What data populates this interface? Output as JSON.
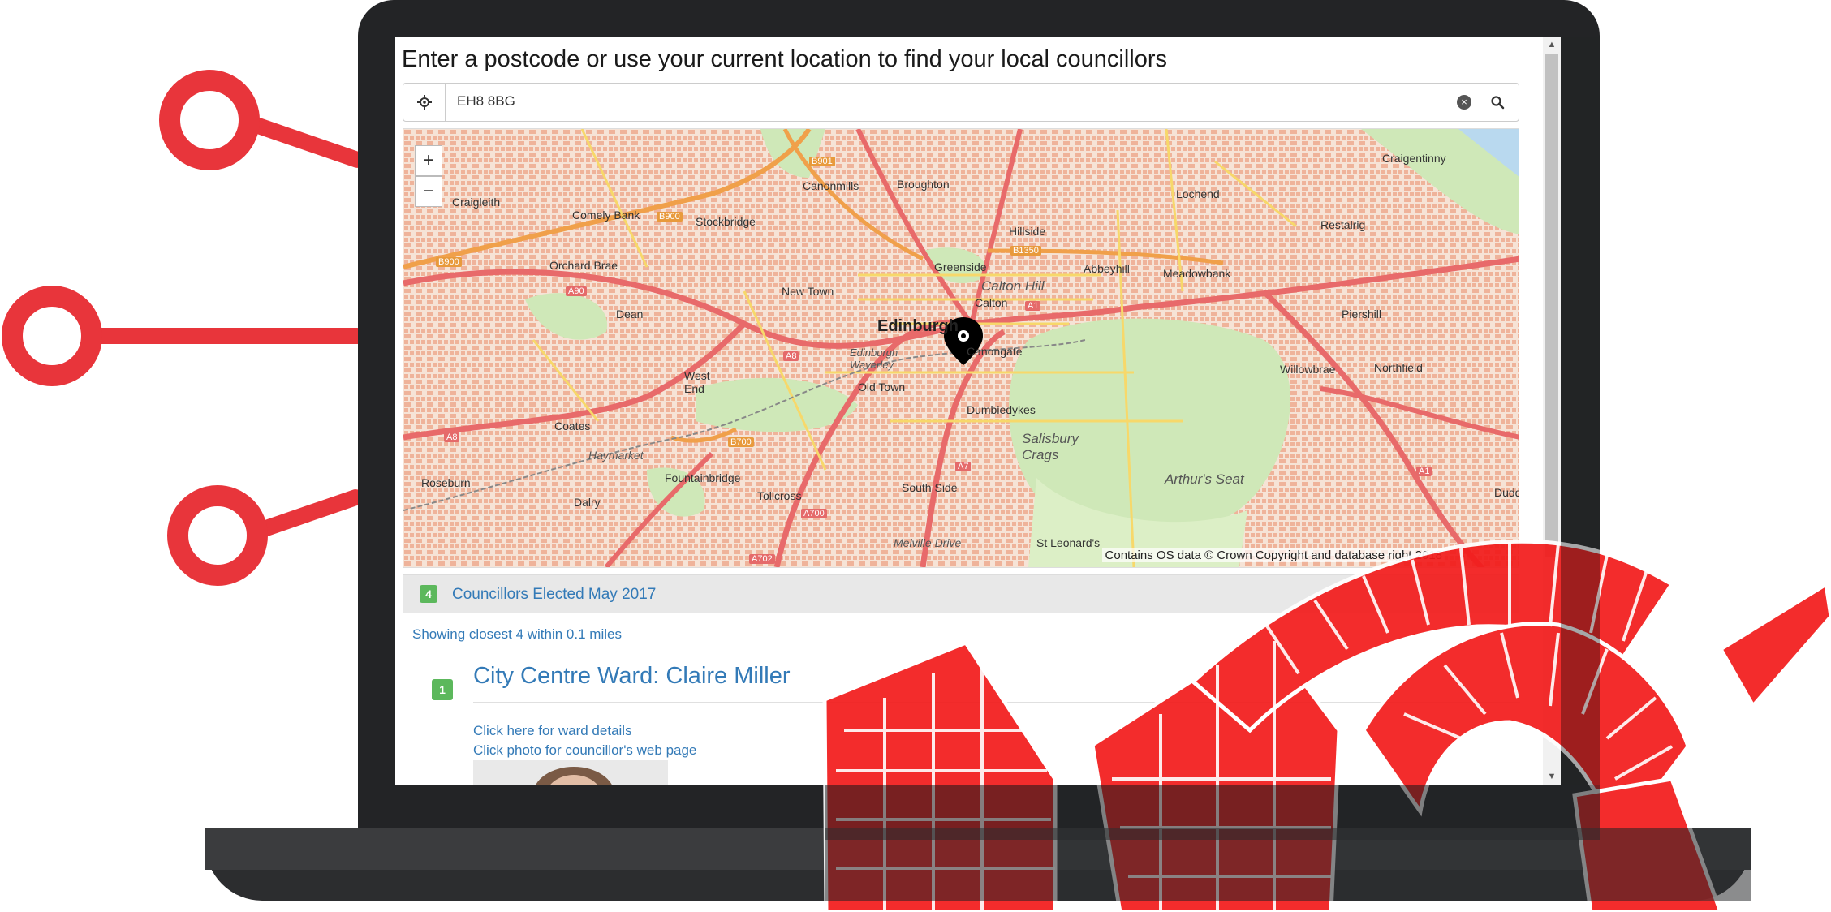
{
  "search": {
    "heading": "Enter a postcode or use your current location to find your local councillors",
    "postcode_value": "EH8 8BG",
    "location_icon": "crosshair-icon",
    "clear_icon": "clear-icon",
    "search_icon": "search-icon"
  },
  "map": {
    "zoom_in": "+",
    "zoom_out": "−",
    "attribution": "Contains OS data © Crown Copyright and database right 2018",
    "marker_icon": "map-pin-icon",
    "labels": {
      "edinburgh": "Edinburgh",
      "craigentinny": "Craigentinny",
      "lochend": "Lochend",
      "restalrig": "Restalrig",
      "broughton": "Broughton",
      "canonmills": "Canonmills",
      "craigleith": "Craigleith",
      "comely_bank": "Comely Bank",
      "stockbridge": "Stockbridge",
      "orchard_brae": "Orchard Brae",
      "hillside": "Hillside",
      "greenside": "Greenside",
      "abbeyhill": "Abbeyhill",
      "meadowbank": "Meadowbank",
      "calton_hill": "Calton Hill",
      "calton": "Calton",
      "new_town": "New Town",
      "dean": "Dean",
      "piershill": "Piershill",
      "canongate": "Canongate",
      "edinburgh_waverley": "Edinburgh Waverley",
      "west_end": "West End",
      "old_town": "Old Town",
      "willowbrae": "Willowbrae",
      "northfield": "Northfield",
      "coates": "Coates",
      "dumbiedykes": "Dumbiedykes",
      "salisbury_crags": "Salisbury Crags",
      "arthurs_seat": "Arthur's Seat",
      "haymarket": "Haymarket",
      "roseburn": "Roseburn",
      "fountainbridge": "Fountainbridge",
      "tollcross": "Tollcross",
      "south_side": "South Side",
      "dalry": "Dalry",
      "meville_drive": "Melville Drive",
      "st_leonards": "St Leonard's",
      "duddingston": "Dudd"
    },
    "roads": {
      "b901": "B901",
      "b900": "B900",
      "b900w": "B900",
      "b1350": "B1350",
      "a90": "A90",
      "a8": "A8",
      "a8w": "A8",
      "b700": "B700",
      "a7": "A7",
      "a700": "A700",
      "a702": "A702",
      "a1": "A1",
      "a1e": "A1"
    }
  },
  "results": {
    "count": "4",
    "header": "Councillors Elected May 2017",
    "showing": "Showing closest 4 within 0.1 miles",
    "first": {
      "rank": "1",
      "title": "City Centre Ward: Claire Miller",
      "ward_link": "Click here for ward details",
      "photo_link": "Click photo for councillor's web page"
    }
  },
  "colors": {
    "accent_red": "#e8353b",
    "link_blue": "#337ab7",
    "badge_green": "#5cb85c",
    "laptop_dark": "#232426"
  }
}
